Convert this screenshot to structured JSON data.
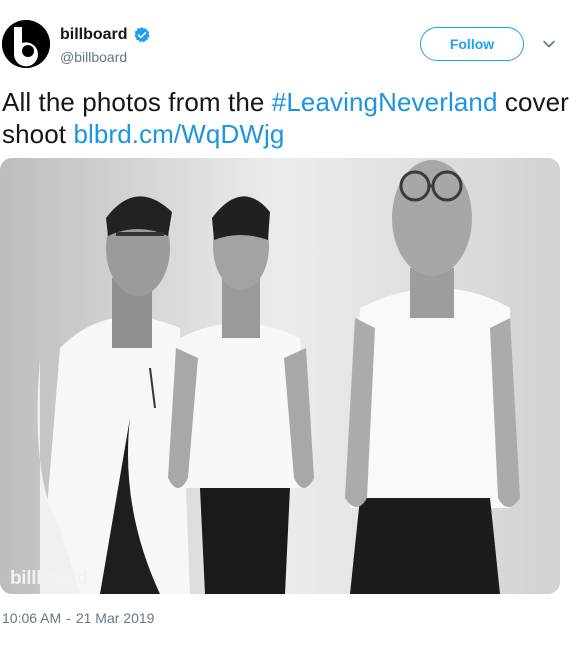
{
  "account": {
    "name": "billboard",
    "handle": "@billboard",
    "avatar_text": "billboard"
  },
  "follow_label": "Follow",
  "tweet": {
    "text_prefix": "All the photos from the ",
    "hashtag": "#LeavingNeverland",
    "text_mid": " cover shoot ",
    "link": "blbrd.cm/WqDWjg"
  },
  "photo": {
    "watermark": "billboard"
  },
  "timestamp": {
    "time": "10:06 AM",
    "separator": "-",
    "date": "21 Mar 2019"
  },
  "colors": {
    "link": "#1b95e0",
    "follow": "#1da1f2",
    "verified": "#1da1f2",
    "meta": "#657786"
  },
  "icons": [
    "billboard-logo-icon",
    "verified-badge-icon",
    "chevron-down-icon"
  ]
}
